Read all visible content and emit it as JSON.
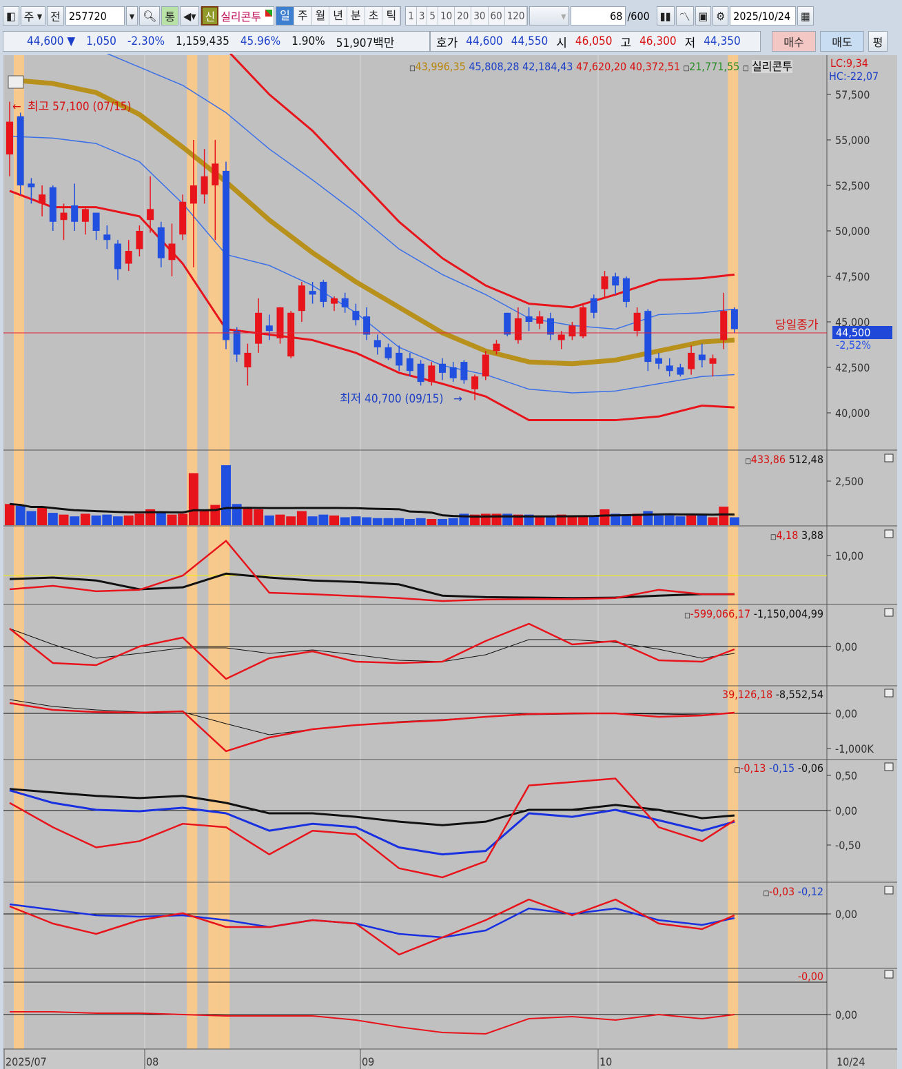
{
  "toolbar": {
    "market": "주",
    "prev": "전",
    "code": "257720",
    "tong": "통",
    "new_badge": "신",
    "name": "실리콘투",
    "periods": [
      "일",
      "주",
      "월",
      "년",
      "분",
      "초",
      "틱"
    ],
    "minutes": [
      "1",
      "3",
      "5",
      "10",
      "20",
      "30",
      "60",
      "120"
    ],
    "count": "68",
    "count_max": "/600",
    "date": "2025/10/24"
  },
  "quote": {
    "price": "44,600",
    "arrow": "▼",
    "change": "1,050",
    "pct": "-2.30%",
    "volume": "1,159,435",
    "vol_ratio": "45.96%",
    "turnover": "1.90%",
    "amount": "51,907백만",
    "hoga_label": "호가",
    "ask": "44,600",
    "bid": "44,550",
    "open_label": "시",
    "open": "46,050",
    "high_label": "고",
    "high": "46,300",
    "low_label": "저",
    "low": "44,350",
    "buy": "매수",
    "sell": "매도",
    "flat": "평"
  },
  "price_legend": {
    "v1": "43,996,35",
    "v2": "45,808,28",
    "v3": "42,184,43",
    "v4": "47,620,20",
    "v5": "40,372,51",
    "v6": "21,771,55",
    "name": "실리콘투",
    "lc": "LC:9,34",
    "hc": "HC:-22,07"
  },
  "annotations": {
    "high": "최고 57,100 (07/15)",
    "low": "최저 40,700 (09/15)",
    "close_label": "당일종가",
    "last_price": "44,500",
    "last_pct": "-2,52%"
  },
  "panel_legends": {
    "volume": [
      "433,86",
      "512,48"
    ],
    "p3": [
      "4,18",
      "3,88"
    ],
    "p4": [
      "-599,066,17",
      "-1,150,004,99"
    ],
    "p5": [
      "39,126,18",
      "-8,552,54"
    ],
    "p6": [
      "-0,13",
      "-0,15",
      "-0,06"
    ],
    "p7": [
      "-0,03",
      "-0,12"
    ],
    "p8": [
      "-0,00"
    ]
  },
  "axes": {
    "price": [
      "57,500",
      "55,000",
      "52,500",
      "50,000",
      "47,500",
      "45,000",
      "42,500",
      "40,000"
    ],
    "volume": "2,500",
    "p3": "10,00",
    "p4": "0,00",
    "p5": [
      "0,00",
      "-1,000K"
    ],
    "p6": [
      "0,50",
      "0,00",
      "-0,50"
    ],
    "p7": "0,00",
    "p8": "0,00",
    "dates": [
      "2025/07",
      "08",
      "09",
      "10"
    ],
    "current_date": "10/24"
  },
  "colors": {
    "up": "#e8141c",
    "down": "#2150e0",
    "gold": "#b8901c",
    "band_blue": "#3a6fe8",
    "bg": "#c0c0c0",
    "highlight": "#f7c98c"
  },
  "chart_data": {
    "type": "candlestick",
    "candles": [
      [
        54.2,
        57.1,
        53.0,
        56.0
      ],
      [
        56.3,
        56.5,
        52.0,
        52.5
      ],
      [
        52.6,
        52.9,
        51.5,
        52.4
      ],
      [
        51.5,
        52.5,
        50.8,
        52.0
      ],
      [
        52.4,
        52.5,
        50.0,
        50.5
      ],
      [
        50.6,
        51.5,
        49.5,
        51.0
      ],
      [
        51.4,
        52.6,
        50.0,
        50.5
      ],
      [
        50.5,
        51.3,
        49.8,
        51.2
      ],
      [
        51.0,
        51.0,
        49.5,
        50.0
      ],
      [
        49.8,
        50.3,
        49.0,
        49.5
      ],
      [
        49.3,
        49.5,
        47.3,
        47.9
      ],
      [
        48.2,
        49.5,
        47.8,
        48.9
      ],
      [
        49.0,
        50.3,
        48.6,
        50.0
      ],
      [
        50.6,
        53.0,
        49.9,
        51.2
      ],
      [
        50.2,
        50.5,
        48.0,
        48.5
      ],
      [
        48.4,
        50.4,
        47.5,
        49.3
      ],
      [
        49.8,
        52.0,
        49.5,
        51.6
      ],
      [
        51.5,
        55.0,
        48.0,
        52.5
      ],
      [
        52.0,
        54.5,
        51.5,
        53.0
      ],
      [
        52.5,
        55.0,
        49.5,
        53.7
      ],
      [
        53.3,
        53.8,
        43.5,
        44.0
      ],
      [
        44.5,
        44.7,
        42.8,
        43.2
      ],
      [
        42.5,
        43.8,
        41.5,
        43.3
      ],
      [
        43.8,
        46.3,
        43.3,
        45.5
      ],
      [
        44.8,
        45.4,
        44.0,
        44.5
      ],
      [
        44.1,
        45.8,
        43.8,
        45.8
      ],
      [
        43.1,
        45.6,
        43.0,
        45.5
      ],
      [
        45.6,
        47.2,
        45.0,
        47.0
      ],
      [
        46.7,
        47.2,
        46.0,
        46.5
      ],
      [
        47.2,
        47.3,
        45.8,
        46.1
      ],
      [
        46.0,
        46.4,
        45.6,
        46.3
      ],
      [
        46.3,
        46.6,
        45.5,
        45.8
      ],
      [
        45.6,
        46.0,
        44.8,
        45.1
      ],
      [
        45.3,
        45.8,
        44.0,
        44.3
      ],
      [
        44.0,
        44.3,
        43.2,
        43.6
      ],
      [
        43.6,
        43.8,
        42.9,
        43.0
      ],
      [
        43.3,
        43.7,
        42.3,
        42.6
      ],
      [
        43.0,
        43.3,
        42.0,
        42.3
      ],
      [
        42.7,
        42.9,
        41.5,
        41.7
      ],
      [
        41.7,
        42.8,
        41.5,
        42.6
      ],
      [
        42.7,
        43.0,
        41.8,
        42.2
      ],
      [
        42.5,
        42.8,
        41.7,
        41.9
      ],
      [
        42.8,
        42.9,
        41.6,
        41.8
      ],
      [
        41.3,
        42.1,
        40.7,
        42.0
      ],
      [
        42.0,
        43.4,
        41.8,
        43.2
      ],
      [
        43.4,
        44.0,
        43.2,
        43.8
      ],
      [
        45.5,
        45.5,
        44.2,
        44.3
      ],
      [
        44.0,
        45.8,
        43.8,
        45.2
      ],
      [
        45.3,
        45.8,
        44.5,
        45.0
      ],
      [
        44.9,
        45.6,
        44.6,
        45.3
      ],
      [
        45.2,
        45.5,
        44.0,
        44.3
      ],
      [
        44.0,
        44.5,
        43.5,
        44.3
      ],
      [
        44.2,
        45.0,
        44.0,
        44.8
      ],
      [
        44.2,
        46.0,
        44.1,
        45.8
      ],
      [
        46.3,
        46.5,
        45.2,
        45.5
      ],
      [
        46.8,
        47.8,
        46.3,
        47.5
      ],
      [
        47.5,
        47.7,
        46.5,
        47.0
      ],
      [
        47.4,
        47.5,
        45.8,
        46.1
      ],
      [
        44.5,
        45.8,
        44.2,
        45.5
      ],
      [
        45.6,
        45.7,
        42.3,
        42.8
      ],
      [
        43.0,
        43.3,
        42.4,
        42.7
      ],
      [
        42.6,
        43.0,
        42.0,
        42.3
      ],
      [
        42.5,
        42.7,
        42.0,
        42.1
      ],
      [
        42.4,
        43.7,
        42.1,
        43.3
      ],
      [
        43.2,
        43.8,
        42.5,
        42.9
      ],
      [
        42.7,
        43.2,
        42.0,
        43.0
      ],
      [
        44.0,
        46.6,
        43.5,
        45.6
      ],
      [
        45.7,
        45.8,
        44.4,
        44.6
      ]
    ],
    "price_unit": "thousand KRW",
    "overlay_index": [
      0,
      4,
      8,
      12,
      16,
      20,
      24,
      28,
      32,
      36,
      40,
      44,
      48,
      52,
      56,
      60,
      64,
      67
    ],
    "overlays": {
      "upper_red": [
        63,
        62,
        61.5,
        61,
        60.5,
        60,
        57.5,
        55.5,
        53,
        50.5,
        48.5,
        47.0,
        46.0,
        45.8,
        46.5,
        47.3,
        47.4,
        47.6
      ],
      "upper_blue": [
        61.5,
        61,
        60,
        59,
        58,
        56.5,
        54.5,
        52.8,
        51,
        49,
        47.6,
        46.5,
        45.2,
        44.8,
        44.6,
        45.4,
        45.5,
        45.7
      ],
      "lower_blue": [
        55.2,
        55.1,
        54.8,
        53.8,
        51.5,
        48.7,
        48.1,
        47.0,
        45.5,
        43.6,
        42.6,
        42.1,
        41.3,
        41.1,
        41.2,
        41.6,
        42.0,
        42.1
      ],
      "lower_red": [
        52.2,
        51.3,
        51.3,
        50.8,
        48.2,
        44.6,
        44.3,
        44.0,
        43.3,
        42.2,
        41.6,
        40.9,
        39.6,
        39.6,
        39.6,
        39.8,
        40.4,
        40.3
      ],
      "gold_ma": [
        58.3,
        58.1,
        57.6,
        56.4,
        54.6,
        52.7,
        50.6,
        48.8,
        47.2,
        45.8,
        44.4,
        43.4,
        42.8,
        42.7,
        42.9,
        43.4,
        43.9,
        44.0
      ]
    },
    "reference_close": 44.4,
    "volume": [
      1200,
      1100,
      800,
      1050,
      700,
      600,
      500,
      650,
      550,
      600,
      500,
      550,
      650,
      900,
      700,
      600,
      650,
      2950,
      800,
      1150,
      3400,
      1200,
      1000,
      900,
      550,
      600,
      500,
      800,
      500,
      600,
      550,
      450,
      500,
      450,
      400,
      400,
      400,
      350,
      400,
      350,
      350,
      400,
      650,
      600,
      650,
      650,
      650,
      600,
      600,
      550,
      550,
      600,
      550,
      550,
      550,
      900,
      650,
      550,
      650,
      800,
      550,
      550,
      500,
      550,
      550,
      450,
      1050,
      450
    ],
    "indicators": {
      "p3": {
        "red": [
          3.1,
          3.8,
          2.7,
          3.0,
          5.9,
          13.0,
          2.4,
          2.1,
          1.7,
          1.3,
          0.7,
          1.0,
          1.1,
          1.1,
          1.3,
          3.0,
          2.1,
          2.1
        ],
        "black": [
          5.2,
          5.5,
          4.9,
          3.1,
          3.5,
          6.3,
          5.5,
          4.9,
          4.6,
          4.1,
          1.8,
          1.5,
          1.4,
          1.3,
          1.4,
          1.8,
          2.1,
          2.1
        ],
        "yellow_level": 5.9
      },
      "p4": {
        "red": [
          3.9,
          -3.6,
          -4.05,
          0,
          1.95,
          -7.05,
          -2.55,
          -1.05,
          -3.3,
          -3.6,
          -3.3,
          1.2,
          4.95,
          0.45,
          1.2,
          -3.0,
          -3.3,
          -0.6
        ],
        "black": [
          3.9,
          0.45,
          -2.55,
          -1.5,
          -0.3,
          -0.3,
          -1.5,
          -0.75,
          -1.8,
          -3.0,
          -3.3,
          -1.8,
          1.5,
          1.5,
          0.9,
          -0.6,
          -2.55,
          -1.5
        ]
      },
      "p5": {
        "red": [
          294,
          98,
          39,
          20,
          59,
          -1078,
          -686,
          -451,
          -333,
          -255,
          -196,
          -98,
          -20,
          0,
          0,
          -98,
          -59,
          20
        ],
        "black": [
          392,
          196,
          98,
          39,
          39,
          -294,
          -608,
          -451,
          -333,
          -235,
          -176,
          -98,
          -39,
          -20,
          0,
          -20,
          -39,
          0
        ]
      },
      "p6": {
        "red": [
          0.11,
          -0.24,
          -0.53,
          -0.44,
          -0.19,
          -0.24,
          -0.63,
          -0.29,
          -0.34,
          -0.83,
          -0.96,
          -0.73,
          0.36,
          0.41,
          0.46,
          -0.24,
          -0.44,
          -0.14
        ],
        "blue": [
          0.29,
          0.11,
          0.01,
          -0.01,
          0.04,
          -0.04,
          -0.29,
          -0.19,
          -0.24,
          -0.53,
          -0.63,
          -0.58,
          -0.04,
          -0.09,
          0.01,
          -0.14,
          -0.29,
          -0.16
        ],
        "black": [
          0.31,
          0.26,
          0.21,
          0.18,
          0.21,
          0.11,
          -0.04,
          -0.04,
          -0.09,
          -0.16,
          -0.21,
          -0.16,
          0.01,
          0.01,
          0.08,
          0.01,
          -0.11,
          -0.07
        ]
      },
      "p7": {
        "red": [
          0.22,
          -0.28,
          -0.58,
          -0.18,
          0.02,
          -0.38,
          -0.38,
          -0.18,
          -0.28,
          -1.18,
          -0.68,
          -0.18,
          0.42,
          -0.04,
          0.42,
          -0.28,
          -0.44,
          -0.04
        ],
        "blue": [
          0.28,
          0.12,
          -0.04,
          -0.08,
          -0.04,
          -0.18,
          -0.38,
          -0.18,
          -0.28,
          -0.58,
          -0.68,
          -0.48,
          0.16,
          0,
          0.16,
          -0.18,
          -0.32,
          -0.12
        ]
      },
      "p8": {
        "red": [
          0.04,
          0.04,
          0.02,
          0.02,
          0,
          -0.02,
          -0.02,
          -0.02,
          -0.08,
          -0.18,
          -0.26,
          -0.28,
          -0.06,
          -0.03,
          -0.08,
          0,
          -0.06,
          0
        ]
      }
    },
    "highlight_candles": [
      0,
      16,
      18,
      19,
      66
    ]
  }
}
